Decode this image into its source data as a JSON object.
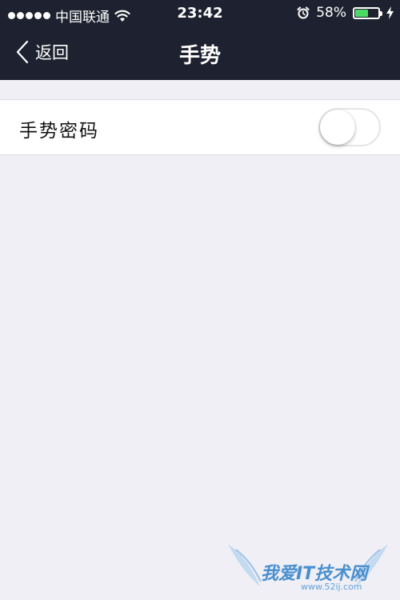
{
  "status_bar": {
    "carrier": "中国联通",
    "time": "23:42",
    "battery_percent": "58%",
    "battery_level": 0.58,
    "battery_color": "#4cd964",
    "icons": [
      "signal-dots-icon",
      "wifi-icon",
      "alarm-icon",
      "battery-icon",
      "charging-icon"
    ]
  },
  "nav": {
    "back_label": "返回",
    "title": "手势",
    "background": "#1e2230"
  },
  "settings": {
    "gesture_password": {
      "label": "手势密码",
      "enabled": false
    }
  },
  "watermark": {
    "text": "我爱IT技术网",
    "url": "www.52ij.com"
  }
}
